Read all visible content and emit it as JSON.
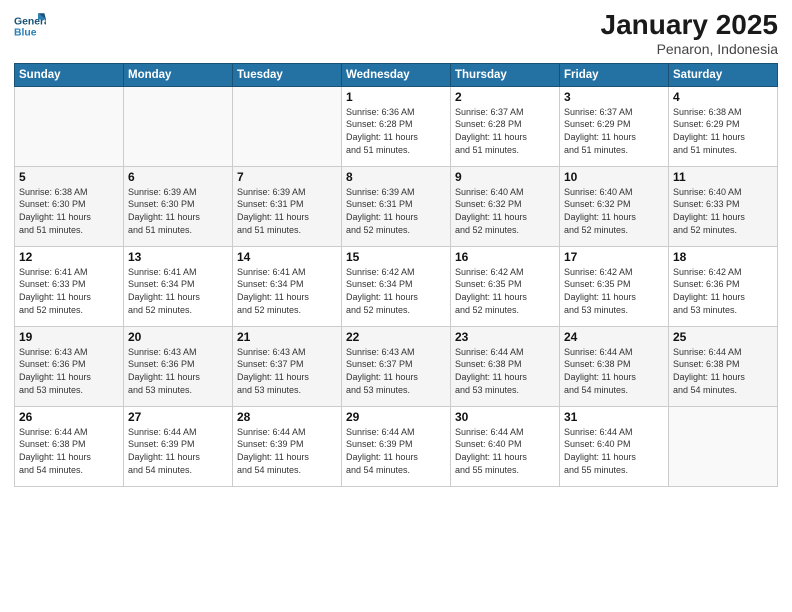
{
  "logo": {
    "line1": "General",
    "line2": "Blue"
  },
  "title": "January 2025",
  "subtitle": "Penaron, Indonesia",
  "days_header": [
    "Sunday",
    "Monday",
    "Tuesday",
    "Wednesday",
    "Thursday",
    "Friday",
    "Saturday"
  ],
  "weeks": [
    [
      {
        "day": "",
        "info": ""
      },
      {
        "day": "",
        "info": ""
      },
      {
        "day": "",
        "info": ""
      },
      {
        "day": "1",
        "info": "Sunrise: 6:36 AM\nSunset: 6:28 PM\nDaylight: 11 hours\nand 51 minutes."
      },
      {
        "day": "2",
        "info": "Sunrise: 6:37 AM\nSunset: 6:28 PM\nDaylight: 11 hours\nand 51 minutes."
      },
      {
        "day": "3",
        "info": "Sunrise: 6:37 AM\nSunset: 6:29 PM\nDaylight: 11 hours\nand 51 minutes."
      },
      {
        "day": "4",
        "info": "Sunrise: 6:38 AM\nSunset: 6:29 PM\nDaylight: 11 hours\nand 51 minutes."
      }
    ],
    [
      {
        "day": "5",
        "info": "Sunrise: 6:38 AM\nSunset: 6:30 PM\nDaylight: 11 hours\nand 51 minutes."
      },
      {
        "day": "6",
        "info": "Sunrise: 6:39 AM\nSunset: 6:30 PM\nDaylight: 11 hours\nand 51 minutes."
      },
      {
        "day": "7",
        "info": "Sunrise: 6:39 AM\nSunset: 6:31 PM\nDaylight: 11 hours\nand 51 minutes."
      },
      {
        "day": "8",
        "info": "Sunrise: 6:39 AM\nSunset: 6:31 PM\nDaylight: 11 hours\nand 52 minutes."
      },
      {
        "day": "9",
        "info": "Sunrise: 6:40 AM\nSunset: 6:32 PM\nDaylight: 11 hours\nand 52 minutes."
      },
      {
        "day": "10",
        "info": "Sunrise: 6:40 AM\nSunset: 6:32 PM\nDaylight: 11 hours\nand 52 minutes."
      },
      {
        "day": "11",
        "info": "Sunrise: 6:40 AM\nSunset: 6:33 PM\nDaylight: 11 hours\nand 52 minutes."
      }
    ],
    [
      {
        "day": "12",
        "info": "Sunrise: 6:41 AM\nSunset: 6:33 PM\nDaylight: 11 hours\nand 52 minutes."
      },
      {
        "day": "13",
        "info": "Sunrise: 6:41 AM\nSunset: 6:34 PM\nDaylight: 11 hours\nand 52 minutes."
      },
      {
        "day": "14",
        "info": "Sunrise: 6:41 AM\nSunset: 6:34 PM\nDaylight: 11 hours\nand 52 minutes."
      },
      {
        "day": "15",
        "info": "Sunrise: 6:42 AM\nSunset: 6:34 PM\nDaylight: 11 hours\nand 52 minutes."
      },
      {
        "day": "16",
        "info": "Sunrise: 6:42 AM\nSunset: 6:35 PM\nDaylight: 11 hours\nand 52 minutes."
      },
      {
        "day": "17",
        "info": "Sunrise: 6:42 AM\nSunset: 6:35 PM\nDaylight: 11 hours\nand 53 minutes."
      },
      {
        "day": "18",
        "info": "Sunrise: 6:42 AM\nSunset: 6:36 PM\nDaylight: 11 hours\nand 53 minutes."
      }
    ],
    [
      {
        "day": "19",
        "info": "Sunrise: 6:43 AM\nSunset: 6:36 PM\nDaylight: 11 hours\nand 53 minutes."
      },
      {
        "day": "20",
        "info": "Sunrise: 6:43 AM\nSunset: 6:36 PM\nDaylight: 11 hours\nand 53 minutes."
      },
      {
        "day": "21",
        "info": "Sunrise: 6:43 AM\nSunset: 6:37 PM\nDaylight: 11 hours\nand 53 minutes."
      },
      {
        "day": "22",
        "info": "Sunrise: 6:43 AM\nSunset: 6:37 PM\nDaylight: 11 hours\nand 53 minutes."
      },
      {
        "day": "23",
        "info": "Sunrise: 6:44 AM\nSunset: 6:38 PM\nDaylight: 11 hours\nand 53 minutes."
      },
      {
        "day": "24",
        "info": "Sunrise: 6:44 AM\nSunset: 6:38 PM\nDaylight: 11 hours\nand 54 minutes."
      },
      {
        "day": "25",
        "info": "Sunrise: 6:44 AM\nSunset: 6:38 PM\nDaylight: 11 hours\nand 54 minutes."
      }
    ],
    [
      {
        "day": "26",
        "info": "Sunrise: 6:44 AM\nSunset: 6:38 PM\nDaylight: 11 hours\nand 54 minutes."
      },
      {
        "day": "27",
        "info": "Sunrise: 6:44 AM\nSunset: 6:39 PM\nDaylight: 11 hours\nand 54 minutes."
      },
      {
        "day": "28",
        "info": "Sunrise: 6:44 AM\nSunset: 6:39 PM\nDaylight: 11 hours\nand 54 minutes."
      },
      {
        "day": "29",
        "info": "Sunrise: 6:44 AM\nSunset: 6:39 PM\nDaylight: 11 hours\nand 54 minutes."
      },
      {
        "day": "30",
        "info": "Sunrise: 6:44 AM\nSunset: 6:40 PM\nDaylight: 11 hours\nand 55 minutes."
      },
      {
        "day": "31",
        "info": "Sunrise: 6:44 AM\nSunset: 6:40 PM\nDaylight: 11 hours\nand 55 minutes."
      },
      {
        "day": "",
        "info": ""
      }
    ]
  ]
}
